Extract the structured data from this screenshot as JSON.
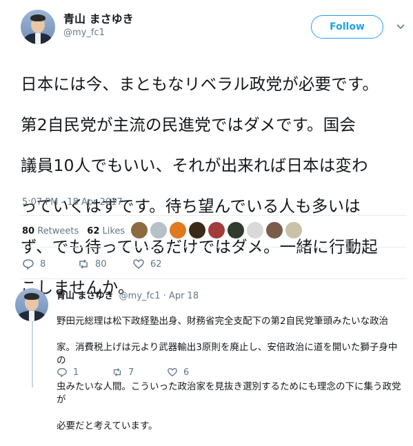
{
  "tweet": {
    "author": {
      "display_name": "青山 まさゆき",
      "screen_name": "@my_fc1"
    },
    "follow_label": "Follow",
    "lines": [
      "日本には今、まともなリベラル政党が必要です。",
      "第2自民党が主流の民進党ではダメです。国会",
      "議員10人でもいい、それが出来れば日本は変わ",
      "っていくはずです。待ち望んでいる人も多いは",
      "ず、でも待っているだけではダメ。一緒に行動起",
      "こしませんか。"
    ],
    "timestamp": "5:07 PM - 18 Apr 2017",
    "retweets_count": "80",
    "retweets_label": "Retweets",
    "likes_count": "62",
    "likes_label": "Likes",
    "actions": {
      "replies": "8",
      "retweets": "80",
      "likes": "62"
    }
  },
  "reply": {
    "display_name": "青山 まさゆき",
    "meta": "@my_fc1 · Apr 18",
    "lines": [
      "野田元総理は松下政経塾出身、財務省完全支配下の第2自民党筆頭みたいな政治",
      "家。消費税上げは元より武器輸出3原則を廃止し、安倍政治に道を開いた獅子身中の",
      "虫みたいな人間。こういった政治家を見抜き選別するためにも理念の下に集う政党が",
      "必要だと考えています。"
    ],
    "actions": {
      "replies": "1",
      "retweets": "7",
      "likes": "6"
    }
  },
  "colors": {
    "accent": "#1da1f2",
    "secondary_text": "#657786",
    "divider": "#e6ecf0"
  },
  "icons": [
    "reply-icon",
    "retweet-icon",
    "heart-icon",
    "chevron-down-icon"
  ]
}
